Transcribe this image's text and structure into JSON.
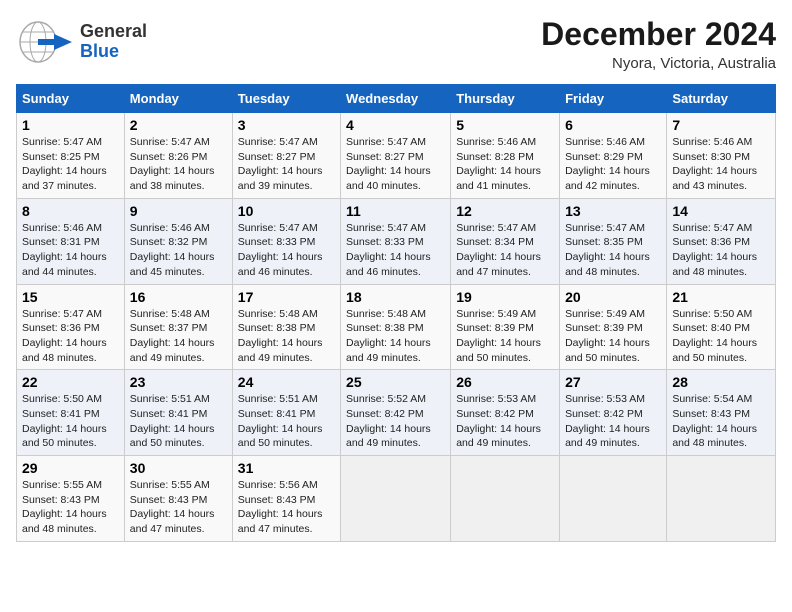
{
  "header": {
    "logo_general": "General",
    "logo_blue": "Blue",
    "title": "December 2024",
    "subtitle": "Nyora, Victoria, Australia"
  },
  "columns": [
    "Sunday",
    "Monday",
    "Tuesday",
    "Wednesday",
    "Thursday",
    "Friday",
    "Saturday"
  ],
  "weeks": [
    [
      {
        "day": "1",
        "info": "Sunrise: 5:47 AM\nSunset: 8:25 PM\nDaylight: 14 hours\nand 37 minutes."
      },
      {
        "day": "2",
        "info": "Sunrise: 5:47 AM\nSunset: 8:26 PM\nDaylight: 14 hours\nand 38 minutes."
      },
      {
        "day": "3",
        "info": "Sunrise: 5:47 AM\nSunset: 8:27 PM\nDaylight: 14 hours\nand 39 minutes."
      },
      {
        "day": "4",
        "info": "Sunrise: 5:47 AM\nSunset: 8:27 PM\nDaylight: 14 hours\nand 40 minutes."
      },
      {
        "day": "5",
        "info": "Sunrise: 5:46 AM\nSunset: 8:28 PM\nDaylight: 14 hours\nand 41 minutes."
      },
      {
        "day": "6",
        "info": "Sunrise: 5:46 AM\nSunset: 8:29 PM\nDaylight: 14 hours\nand 42 minutes."
      },
      {
        "day": "7",
        "info": "Sunrise: 5:46 AM\nSunset: 8:30 PM\nDaylight: 14 hours\nand 43 minutes."
      }
    ],
    [
      {
        "day": "8",
        "info": "Sunrise: 5:46 AM\nSunset: 8:31 PM\nDaylight: 14 hours\nand 44 minutes."
      },
      {
        "day": "9",
        "info": "Sunrise: 5:46 AM\nSunset: 8:32 PM\nDaylight: 14 hours\nand 45 minutes."
      },
      {
        "day": "10",
        "info": "Sunrise: 5:47 AM\nSunset: 8:33 PM\nDaylight: 14 hours\nand 46 minutes."
      },
      {
        "day": "11",
        "info": "Sunrise: 5:47 AM\nSunset: 8:33 PM\nDaylight: 14 hours\nand 46 minutes."
      },
      {
        "day": "12",
        "info": "Sunrise: 5:47 AM\nSunset: 8:34 PM\nDaylight: 14 hours\nand 47 minutes."
      },
      {
        "day": "13",
        "info": "Sunrise: 5:47 AM\nSunset: 8:35 PM\nDaylight: 14 hours\nand 48 minutes."
      },
      {
        "day": "14",
        "info": "Sunrise: 5:47 AM\nSunset: 8:36 PM\nDaylight: 14 hours\nand 48 minutes."
      }
    ],
    [
      {
        "day": "15",
        "info": "Sunrise: 5:47 AM\nSunset: 8:36 PM\nDaylight: 14 hours\nand 48 minutes."
      },
      {
        "day": "16",
        "info": "Sunrise: 5:48 AM\nSunset: 8:37 PM\nDaylight: 14 hours\nand 49 minutes."
      },
      {
        "day": "17",
        "info": "Sunrise: 5:48 AM\nSunset: 8:38 PM\nDaylight: 14 hours\nand 49 minutes."
      },
      {
        "day": "18",
        "info": "Sunrise: 5:48 AM\nSunset: 8:38 PM\nDaylight: 14 hours\nand 49 minutes."
      },
      {
        "day": "19",
        "info": "Sunrise: 5:49 AM\nSunset: 8:39 PM\nDaylight: 14 hours\nand 50 minutes."
      },
      {
        "day": "20",
        "info": "Sunrise: 5:49 AM\nSunset: 8:39 PM\nDaylight: 14 hours\nand 50 minutes."
      },
      {
        "day": "21",
        "info": "Sunrise: 5:50 AM\nSunset: 8:40 PM\nDaylight: 14 hours\nand 50 minutes."
      }
    ],
    [
      {
        "day": "22",
        "info": "Sunrise: 5:50 AM\nSunset: 8:41 PM\nDaylight: 14 hours\nand 50 minutes."
      },
      {
        "day": "23",
        "info": "Sunrise: 5:51 AM\nSunset: 8:41 PM\nDaylight: 14 hours\nand 50 minutes."
      },
      {
        "day": "24",
        "info": "Sunrise: 5:51 AM\nSunset: 8:41 PM\nDaylight: 14 hours\nand 50 minutes."
      },
      {
        "day": "25",
        "info": "Sunrise: 5:52 AM\nSunset: 8:42 PM\nDaylight: 14 hours\nand 49 minutes."
      },
      {
        "day": "26",
        "info": "Sunrise: 5:53 AM\nSunset: 8:42 PM\nDaylight: 14 hours\nand 49 minutes."
      },
      {
        "day": "27",
        "info": "Sunrise: 5:53 AM\nSunset: 8:42 PM\nDaylight: 14 hours\nand 49 minutes."
      },
      {
        "day": "28",
        "info": "Sunrise: 5:54 AM\nSunset: 8:43 PM\nDaylight: 14 hours\nand 48 minutes."
      }
    ],
    [
      {
        "day": "29",
        "info": "Sunrise: 5:55 AM\nSunset: 8:43 PM\nDaylight: 14 hours\nand 48 minutes."
      },
      {
        "day": "30",
        "info": "Sunrise: 5:55 AM\nSunset: 8:43 PM\nDaylight: 14 hours\nand 47 minutes."
      },
      {
        "day": "31",
        "info": "Sunrise: 5:56 AM\nSunset: 8:43 PM\nDaylight: 14 hours\nand 47 minutes."
      },
      {
        "day": "",
        "info": ""
      },
      {
        "day": "",
        "info": ""
      },
      {
        "day": "",
        "info": ""
      },
      {
        "day": "",
        "info": ""
      }
    ]
  ]
}
